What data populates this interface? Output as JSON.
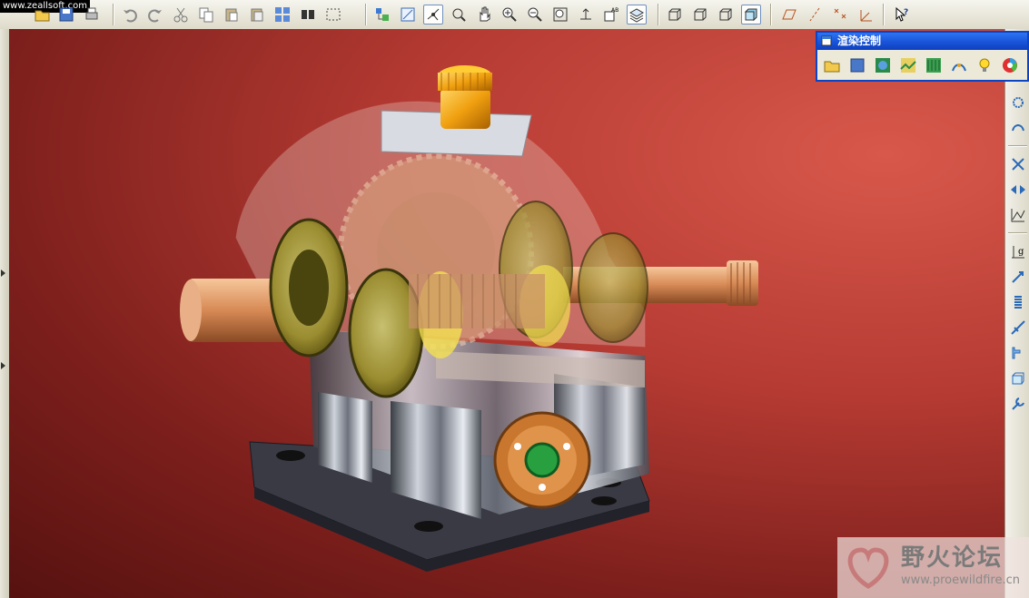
{
  "watermark_top_left": "www.zeallsoft.com",
  "render_panel": {
    "title": "渲染控制",
    "tools": [
      "open-folder-icon",
      "save-scene-icon",
      "room-icon",
      "lights-icon",
      "scene-icon",
      "appearance-icon",
      "effects-icon",
      "bulb-icon",
      "color-wheel-icon"
    ]
  },
  "watermark_bottom_right": {
    "title": "野火论坛",
    "url": "www.proewildfire.cn"
  },
  "toolbar_icons": [
    "new-icon",
    "open-icon",
    "save-icon",
    "print-icon",
    "undo-icon",
    "redo-icon",
    "cut-icon",
    "copy-icon",
    "paste-icon",
    "paste-special-icon",
    "regenerate-icon",
    "find-icon",
    "select-box-icon",
    "layer-tree-icon",
    "sketch-icon",
    "spin-center-icon",
    "named-view-icon",
    "pan-icon",
    "zoom-in-icon",
    "zoom-out-icon",
    "refit-icon",
    "orient-icon",
    "view-manager-icon",
    "layers-icon",
    "wireframe-icon",
    "hidden-line-icon",
    "no-hidden-icon",
    "shading-icon",
    "datum-plane-icon",
    "datum-axis-icon",
    "datum-point-icon",
    "datum-csys-icon",
    "context-help-icon"
  ],
  "right_toolbar_icons": [
    "gear-icon",
    "spring-icon",
    "cross-icon",
    "arrows-icon",
    "graph-icon",
    "chart-icon",
    "pen-icon",
    "coil-icon",
    "measure-icon",
    "profile-icon",
    "box-icon",
    "wrench-icon"
  ],
  "colors": {
    "accent": "#0b44c4",
    "viewport": "#b63b33"
  }
}
